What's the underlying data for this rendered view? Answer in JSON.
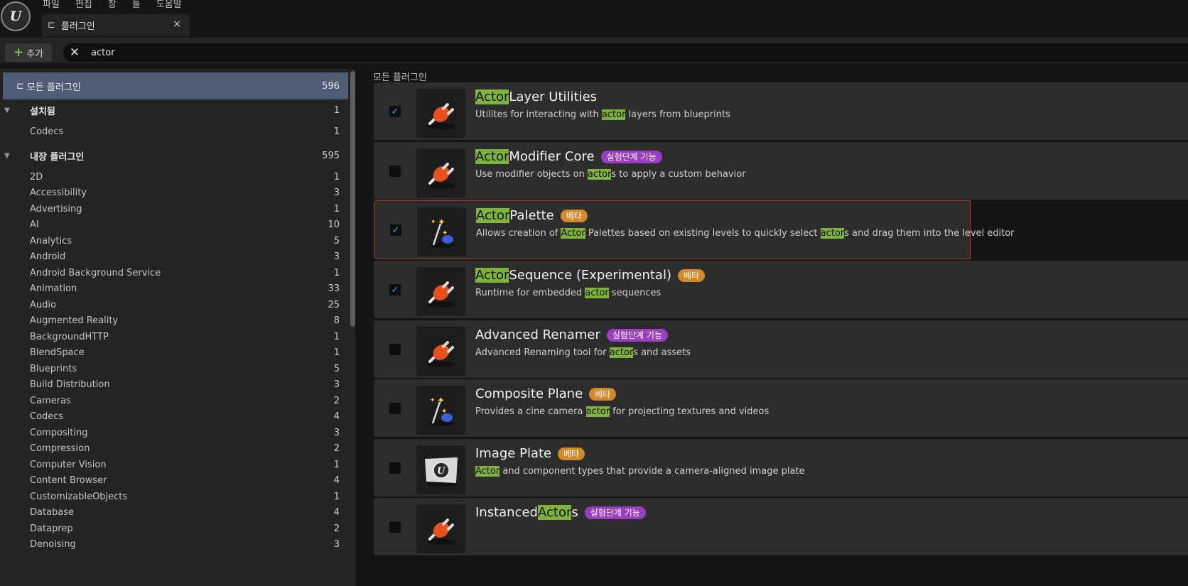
{
  "menu": [
    "파일",
    "편집",
    "창",
    "툴",
    "도움말"
  ],
  "tab": {
    "label": "플러그인",
    "close": "×"
  },
  "toolbar": {
    "add_label": "추가",
    "search_value": "actor"
  },
  "sidebar": {
    "all": {
      "label": "모든 플러그인",
      "count": "596"
    },
    "rows": [
      {
        "label": "설치됨",
        "count": "1",
        "section": true
      },
      {
        "label": "Codecs",
        "count": "1"
      },
      {
        "label": "내장 플러그인",
        "count": "595",
        "section": true
      },
      {
        "label": "2D",
        "count": "1"
      },
      {
        "label": "Accessibility",
        "count": "3"
      },
      {
        "label": "Advertising",
        "count": "1"
      },
      {
        "label": "AI",
        "count": "10"
      },
      {
        "label": "Analytics",
        "count": "5"
      },
      {
        "label": "Android",
        "count": "3"
      },
      {
        "label": "Android Background Service",
        "count": "1"
      },
      {
        "label": "Animation",
        "count": "33"
      },
      {
        "label": "Audio",
        "count": "25"
      },
      {
        "label": "Augmented Reality",
        "count": "8"
      },
      {
        "label": "BackgroundHTTP",
        "count": "1"
      },
      {
        "label": "BlendSpace",
        "count": "1"
      },
      {
        "label": "Blueprints",
        "count": "5"
      },
      {
        "label": "Build Distribution",
        "count": "3"
      },
      {
        "label": "Cameras",
        "count": "2"
      },
      {
        "label": "Codecs",
        "count": "4"
      },
      {
        "label": "Compositing",
        "count": "3"
      },
      {
        "label": "Compression",
        "count": "2"
      },
      {
        "label": "Computer Vision",
        "count": "1"
      },
      {
        "label": "Content Browser",
        "count": "4"
      },
      {
        "label": "CustomizableObjects",
        "count": "1"
      },
      {
        "label": "Database",
        "count": "4"
      },
      {
        "label": "Dataprep",
        "count": "2"
      },
      {
        "label": "Denoising",
        "count": "3"
      }
    ]
  },
  "main": {
    "title": "모든 플러그인",
    "plugins": [
      {
        "name_hl": "Actor",
        "name_rest": " Layer Utilities",
        "name_pre": "",
        "badge": "",
        "badge_type": "",
        "checked": true,
        "icon": "plug",
        "desc": [
          [
            "Utilites for interacting with ",
            false
          ],
          [
            "actor",
            true
          ],
          [
            " layers from blueprints",
            false
          ]
        ]
      },
      {
        "name_hl": "Actor",
        "name_rest": " Modifier Core",
        "name_pre": "",
        "badge": "실험단계 기능",
        "badge_type": "exp",
        "checked": false,
        "icon": "plug",
        "desc": [
          [
            "Use modifier objects on ",
            false
          ],
          [
            "actor",
            true
          ],
          [
            "s to apply a custom behavior",
            false
          ]
        ]
      },
      {
        "name_hl": "Actor",
        "name_rest": " Palette",
        "name_pre": "",
        "badge": "베타",
        "badge_type": "beta",
        "checked": true,
        "icon": "wand",
        "selected": true,
        "desc": [
          [
            "Allows creation of ",
            false
          ],
          [
            "Actor",
            true
          ],
          [
            " Palettes based on existing levels to quickly select ",
            false
          ],
          [
            "actor",
            true
          ],
          [
            "s and drag them into the level editor",
            false
          ]
        ]
      },
      {
        "name_hl": "Actor",
        "name_rest": " Sequence (Experimental)",
        "name_pre": "",
        "badge": "베타",
        "badge_type": "beta",
        "checked": true,
        "icon": "plug",
        "desc": [
          [
            "Runtime for embedded ",
            false
          ],
          [
            "actor",
            true
          ],
          [
            " sequences",
            false
          ]
        ]
      },
      {
        "name_hl": "",
        "name_rest": "Advanced Renamer",
        "name_pre": "",
        "badge": "실험단계 기능",
        "badge_type": "exp",
        "checked": false,
        "icon": "plug",
        "desc": [
          [
            "Advanced Renaming tool for ",
            false
          ],
          [
            "actor",
            true
          ],
          [
            "s and assets",
            false
          ]
        ]
      },
      {
        "name_hl": "",
        "name_rest": "Composite Plane",
        "name_pre": "",
        "badge": "베타",
        "badge_type": "beta",
        "checked": false,
        "icon": "wand",
        "desc": [
          [
            "Provides a cine camera ",
            false
          ],
          [
            "actor",
            true
          ],
          [
            " for projecting textures and videos",
            false
          ]
        ]
      },
      {
        "name_hl": "",
        "name_rest": "Image Plate",
        "name_pre": "",
        "badge": "베타",
        "badge_type": "beta",
        "checked": false,
        "icon": "ue",
        "desc": [
          [
            "Actor",
            true
          ],
          [
            " and component types that provide a camera-aligned image plate",
            false
          ]
        ]
      },
      {
        "name_hl": "Actor",
        "name_rest": "s",
        "name_pre": "Instanced",
        "badge": "실험단계 기능",
        "badge_type": "exp",
        "checked": false,
        "icon": "plug",
        "desc": []
      }
    ]
  },
  "colors": {
    "highlight": "#7fb43a",
    "experimental": "#9b3fc2",
    "beta": "#d28a2a",
    "selected_border": "#b83a32",
    "sidebar_selected": "#4e5d75"
  }
}
